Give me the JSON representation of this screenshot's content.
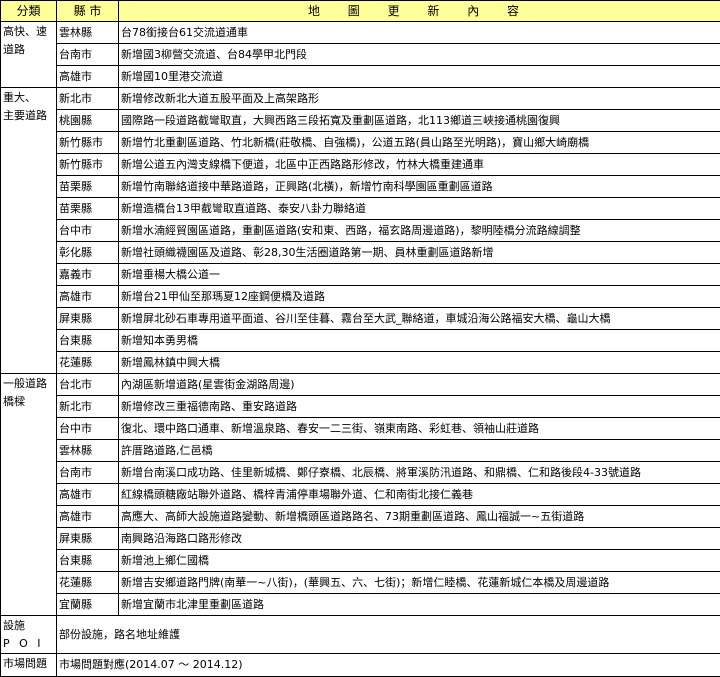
{
  "header": {
    "category": "分類",
    "city": "縣 市",
    "content": "地 圖 更 新 內 容"
  },
  "groups": [
    {
      "category_lines": [
        "高快、速",
        "道路"
      ],
      "rows": [
        {
          "city": "雲林縣",
          "content": "台78銜接台61交流道通車"
        },
        {
          "city": "台南市",
          "content": "新增國3柳營交流道、台84學甲北門段"
        },
        {
          "city": "高雄市",
          "content": "新增國10里港交流道"
        }
      ]
    },
    {
      "category_lines": [
        "重大、",
        "主要道路"
      ],
      "rows": [
        {
          "city": "新北市",
          "content": "新增修改新北大道五股平面及上高架路形"
        },
        {
          "city": "桃園縣",
          "content": "國際路一段道路截彎取直，大興西路三段拓寬及重劃區道路，北113鄉道三峽接通桃園復興"
        },
        {
          "city": "新竹縣市",
          "content": "新增竹北重劃區道路、竹北新橋(莊敬橋、自強橋)，公道五路(員山路至光明路)，寶山鄉大崎廟橋"
        },
        {
          "city": "新竹縣市",
          "content": "新增公道五內灣支線橋下便道，北區中正西路路形修改，竹林大橋重建通車"
        },
        {
          "city": "苗栗縣",
          "content": "新增竹南聯絡道接中華路道路，正興路(北橫)，新增竹南科學園區重劃區道路"
        },
        {
          "city": "苗栗縣",
          "content": "新增造橋台13甲截彎取直道路、泰安八卦力聯絡道"
        },
        {
          "city": "台中市",
          "content": "新增水湳經貿園區道路，重劃區道路(安和東、西路，福玄路周邊道路)，黎明陸橋分流路線調整"
        },
        {
          "city": "彰化縣",
          "content": "新增社頭織襪園區及道路、彰28,30生活圈道路第一期、員林重劃區道路新增"
        },
        {
          "city": "嘉義市",
          "content": "新增垂楊大橋公道一"
        },
        {
          "city": "高雄市",
          "content": "新增台21甲仙至那瑪夏12座鋼便橋及道路"
        },
        {
          "city": "屏東縣",
          "content": "新增屏北砂石車專用道平面道、谷川至佳暮、霧台至大武_聯絡道，車城沿海公路福安大橋、龜山大橋"
        },
        {
          "city": "台東縣",
          "content": "新增知本勇男橋"
        },
        {
          "city": "花蓮縣",
          "content": "新增鳳林鎮中興大橋"
        }
      ]
    },
    {
      "category_lines": [
        "一般道路",
        "橋樑"
      ],
      "rows": [
        {
          "city": "台北市",
          "content": "內湖區新增道路(星雲街金湖路周邊)"
        },
        {
          "city": "新北市",
          "content": "新增修改三重福德南路、重安路道路"
        },
        {
          "city": "台中市",
          "content": "復北、環中路口通車、新增溫泉路、春安一二三街、嶺東南路、彩虹巷、領袖山莊道路"
        },
        {
          "city": "雲林縣",
          "content": "許厝路道路,仁邑橋"
        },
        {
          "city": "台南市",
          "content": "新增台南溪口成功路、佳里新城橋、鄭仔寮橋、北辰橋、將軍溪防汛道路、和鼎橋、仁和路後段4-33號道路"
        },
        {
          "city": "高雄市",
          "content": "紅線橋頭糖廠站聯外道路、橋梓青浦停車場聯外道、仁和南街北接仁義巷"
        },
        {
          "city": "高雄市",
          "content": "高應大、高師大設施道路變動、新增橋頭區道路路名、73期重劃區道路、鳳山福誠一~五街道路"
        },
        {
          "city": "屏東縣",
          "content": "南興路沿海路口路形修改"
        },
        {
          "city": "台東縣",
          "content": "新增池上鄉仁國橋"
        },
        {
          "city": "花蓮縣",
          "content": "新增吉安鄉道路門牌(南華一~八街)，(華興五、六、七街)；新增仁睦橋、花蓮新城仁本橋及周邊道路"
        },
        {
          "city": "宜蘭縣",
          "content": "新增宜蘭市北津里重劃區道路"
        }
      ]
    },
    {
      "category_lines": [
        "設施",
        "P O I"
      ],
      "span_content": "部份設施，路名地址維護"
    },
    {
      "category_lines": [
        "市場問題"
      ],
      "span_content": "市場問題對應(2014.07 ～ 2014.12)"
    }
  ]
}
